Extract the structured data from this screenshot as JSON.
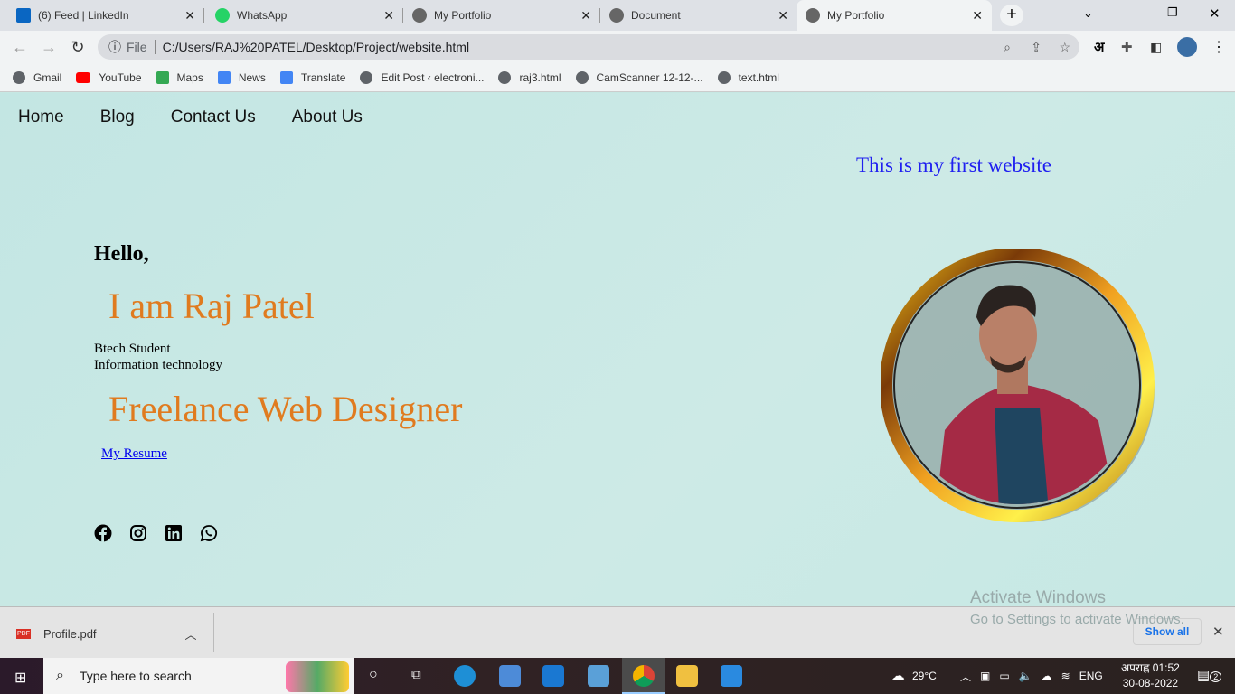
{
  "browser": {
    "tabs": [
      {
        "title": "(6) Feed | LinkedIn",
        "icon": "linkedin-icon"
      },
      {
        "title": "WhatsApp",
        "icon": "whatsapp-icon"
      },
      {
        "title": "My Portfolio",
        "icon": "globe-icon"
      },
      {
        "title": "Document",
        "icon": "globe-icon"
      },
      {
        "title": "My Portfolio",
        "icon": "globe-icon",
        "active": true
      }
    ],
    "new_tab": "+",
    "address": {
      "scheme": "File",
      "url": "C:/Users/RAJ%20PATEL/Desktop/Project/website.html"
    },
    "lang_button": "अ",
    "bookmarks": [
      "Gmail",
      "YouTube",
      "Maps",
      "News",
      "Translate",
      "Edit Post ‹ electroni...",
      "raj3.html",
      "CamScanner 12-12-...",
      "text.html"
    ]
  },
  "page": {
    "nav": [
      "Home",
      "Blog",
      "Contact Us",
      "About Us"
    ],
    "tagline": "This is my first website",
    "hello": "Hello,",
    "name": "I am Raj Patel",
    "degree": "Btech Student",
    "branch": "Information technology",
    "role": "Freelance Web Designer",
    "resume_link": "My Resume",
    "social": [
      "facebook-icon",
      "instagram-icon",
      "linkedin-icon",
      "whatsapp-icon"
    ],
    "colors": {
      "accent": "#e07b1f",
      "link": "#0000ee",
      "tagline": "#2020f0",
      "background": "#c6e7e3"
    }
  },
  "watermark": {
    "title": "Activate Windows",
    "subtitle": "Go to Settings to activate Windows."
  },
  "downloads": {
    "file": "Profile.pdf",
    "show_all": "Show all"
  },
  "taskbar": {
    "search_placeholder": "Type here to search",
    "weather": "29°C",
    "lang": "ENG",
    "time": "अपराह्न 01:52",
    "date": "30-08-2022",
    "notifications": "2"
  }
}
